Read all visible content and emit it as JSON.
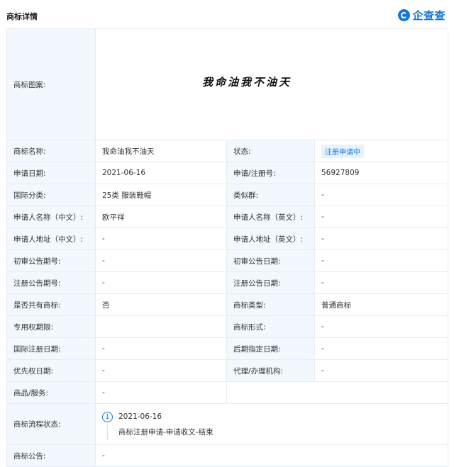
{
  "header": {
    "title": "商标详情",
    "brand": "企查查"
  },
  "logo": {
    "label": "商标图案:",
    "text": "我命油我不油天"
  },
  "rows": {
    "name_label": "商标名称:",
    "name_value": "我命油我不油天",
    "status_label": "状态:",
    "status_value": "注册申请中",
    "date_label": "申请日期:",
    "date_value": "2021-06-16",
    "regno_label": "申请/注册号:",
    "regno_value": "56927809",
    "class_label": "国际分类:",
    "class_value": "25类 服装鞋帽",
    "similar_label": "类似群:",
    "similar_value": "-",
    "applicant_cn_label": "申请人名称（中文）:",
    "applicant_cn_value": "欧平祥",
    "applicant_en_label": "申请人名称（英文）:",
    "applicant_en_value": "-",
    "addr_cn_label": "申请人地址（中文）:",
    "addr_cn_value": "-",
    "addr_en_label": "申请人地址（英文）:",
    "addr_en_value": "-",
    "prelim_no_label": "初审公告期号:",
    "prelim_no_value": "-",
    "prelim_date_label": "初审公告日期:",
    "prelim_date_value": "-",
    "reg_no_label": "注册公告期号:",
    "reg_no_value": "-",
    "reg_date_label": "注册公告日期:",
    "reg_date_value": "-",
    "shared_label": "是否共有商标:",
    "shared_value": "否",
    "type_label": "商标类型:",
    "type_value": "普通商标",
    "period_label": "专用权期限:",
    "period_value": "",
    "form_label": "商标形式:",
    "form_value": "-",
    "intl_date_label": "国际注册日期:",
    "intl_date_value": "-",
    "later_date_label": "后期指定日期:",
    "later_date_value": "-",
    "priority_label": "优先权日期:",
    "priority_value": "-",
    "agent_label": "代理/办理机构:",
    "agent_value": "-",
    "goods_label": "商品/服务:",
    "goods_value": "-",
    "flow_label": "商标流程状态:",
    "notice_label": "商标公告:",
    "notice_value": "-"
  },
  "flow": [
    {
      "step": "1",
      "date": "2021-06-16",
      "desc": "商标注册申请-申请收文-结束"
    }
  ],
  "colors": {
    "accent": "#1677d6",
    "label_bg": "#f3f8fe",
    "border": "#e6ecf3"
  }
}
